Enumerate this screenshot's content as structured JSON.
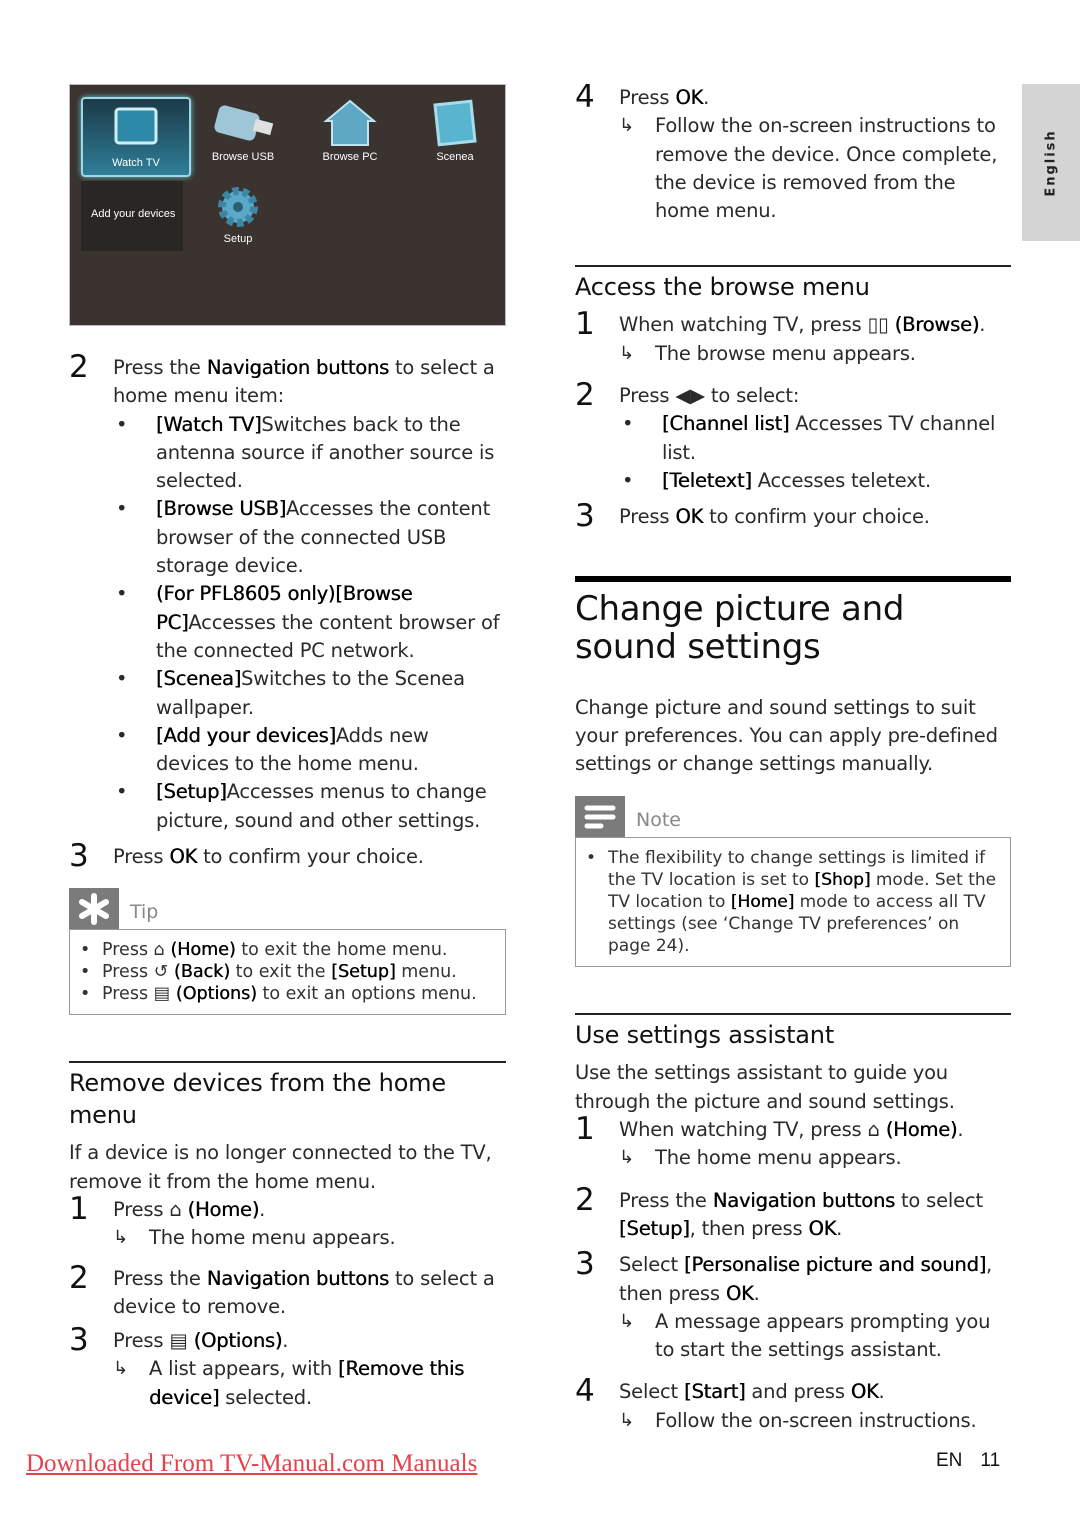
{
  "tv_menu": {
    "tiles": [
      {
        "label": "Watch TV",
        "icon": "tv-icon",
        "selected": true
      },
      {
        "label": "Browse USB",
        "icon": "usb-icon"
      },
      {
        "label": "Browse PC",
        "icon": "house-icon"
      },
      {
        "label": "Scenea",
        "icon": "picture-frame-icon"
      },
      {
        "label": "Add your devices",
        "icon": ""
      },
      {
        "label": "Setup",
        "icon": "gear-icon"
      }
    ]
  },
  "left": {
    "step2": {
      "num": "2",
      "pre": "Press the ",
      "kw": "Navigation buttons",
      "post": " to select a home menu item:",
      "bullets": [
        {
          "kw": "[Watch TV]",
          "text": "Switches back to the antenna source if another source is selected."
        },
        {
          "kw": "[Browse USB]",
          "text": "Accesses the content browser of the connected USB storage device."
        },
        {
          "kw": "(For PFL8605 only)[Browse PC]",
          "text": "Accesses the content browser of the connected PC network."
        },
        {
          "kw": "[Scenea]",
          "text": "Switches to the Scenea wallpaper."
        },
        {
          "kw": "[Add your devices]",
          "text": "Adds new devices to the home menu."
        },
        {
          "kw": "[Setup]",
          "text": "Accesses menus to change picture, sound and other settings."
        }
      ]
    },
    "step3": {
      "num": "3",
      "pre": "Press ",
      "kw": "OK",
      "post": " to confirm your choice."
    },
    "tip": {
      "label": "Tip",
      "lines": [
        {
          "pre": "Press ",
          "icon": "home-icon",
          "glyph": "⌂",
          "kw": "(Home)",
          "post": " to exit the home menu."
        },
        {
          "pre": "Press ",
          "icon": "back-icon",
          "glyph": "↺",
          "kw": "(Back)",
          "post": " to exit the ",
          "kw2": "[Setup]",
          "post2": " menu."
        },
        {
          "pre": "Press ",
          "icon": "options-icon",
          "glyph": "▤",
          "kw": "(Options)",
          "post": " to exit an options menu."
        }
      ]
    },
    "remove_section": {
      "title": "Remove devices from the home menu",
      "intro": "If a device is no longer connected to the TV, remove it from the home menu.",
      "steps": [
        {
          "num": "1",
          "pre": "Press ",
          "kw": "(Home)",
          "post": ".",
          "result": "The home menu appears."
        },
        {
          "num": "2",
          "pre": "Press the ",
          "kw": "Navigation buttons",
          "post": " to select a device to remove."
        },
        {
          "num": "3",
          "pre": "Press ",
          "kw": "(Options)",
          "post": ".",
          "result_pre": "A list appears, with ",
          "result_kw": "[Remove this device]",
          "result_post": " selected."
        }
      ]
    }
  },
  "right": {
    "remove_step4": {
      "num": "4",
      "pre": "Press ",
      "kw": "OK",
      "post": ".",
      "result": "Follow the on-screen instructions to remove the device. Once complete, the device is removed from the home menu."
    },
    "browse_section": {
      "title": "Access the browse menu",
      "step1": {
        "num": "1",
        "pre": "When watching TV, press ",
        "kw": "(Browse)",
        "post": ".",
        "result": "The browse menu appears."
      },
      "step2": {
        "num": "2",
        "pre": "Press ",
        "post": " to select:",
        "bullets": [
          {
            "kw": "[Channel list]",
            "text": " Accesses TV channel list."
          },
          {
            "kw": "[Teletext]",
            "text": " Accesses teletext."
          }
        ]
      },
      "step3": {
        "num": "3",
        "pre": "Press ",
        "kw": "OK",
        "post": " to confirm your choice."
      }
    },
    "change_section": {
      "title": "Change picture and sound settings",
      "intro": "Change picture and sound settings to suit your preferences. You can apply pre-defined settings or change settings manually.",
      "note": {
        "label": "Note",
        "pre": "The flexibility to change settings is limited if the TV location is set to ",
        "kw": "[Shop]",
        "mid": " mode. Set the TV location to ",
        "kw2": "[Home]",
        "post": " mode to access all TV settings (see ‘Change TV preferences’ on page 24)."
      }
    },
    "assistant_section": {
      "title": "Use settings assistant",
      "intro": "Use the settings assistant to guide you through the picture and sound settings.",
      "steps": [
        {
          "num": "1",
          "pre": "When watching TV, press ",
          "kw": "(Home)",
          "post": ".",
          "result": "The home menu appears."
        },
        {
          "num": "2",
          "pre": "Press the ",
          "kw": "Navigation buttons",
          "post": " to select ",
          "kw2": "[Setup]",
          "post2": ", then press ",
          "kw3": "OK",
          "post3": "."
        },
        {
          "num": "3",
          "pre": "Select ",
          "kw": "[Personalise picture and sound]",
          "post": ", then press ",
          "kw2": "OK",
          "post2": ".",
          "result": "A message appears prompting you to start the settings assistant."
        },
        {
          "num": "4",
          "pre": "Select ",
          "kw": "[Start]",
          "post": " and press ",
          "kw2": "OK",
          "post2": ".",
          "result": "Follow the on-screen instructions."
        }
      ]
    }
  },
  "side_tab": {
    "label": "English"
  },
  "footer": {
    "link": "Downloaded From TV-Manual.com Manuals",
    "lang": "EN",
    "page": "11"
  },
  "colors": {
    "link": "#e8404a",
    "tip_icon_bg": "#7b7b7b",
    "side_tab_bg": "#d4d4d4"
  }
}
